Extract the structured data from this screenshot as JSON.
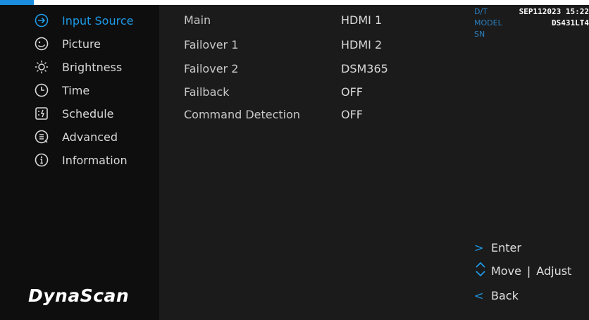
{
  "colors": {
    "accent": "#1e9ae6",
    "sidebar_bg": "#0e0e0e",
    "main_bg": "#1b1b1b"
  },
  "sidebar": {
    "items": [
      {
        "label": "Input Source",
        "icon": "input-arrow-icon",
        "active": true
      },
      {
        "label": "Picture",
        "icon": "picture-face-icon",
        "active": false
      },
      {
        "label": "Brightness",
        "icon": "brightness-sun-icon",
        "active": false
      },
      {
        "label": "Time",
        "icon": "clock-icon",
        "active": false
      },
      {
        "label": "Schedule",
        "icon": "schedule-icon",
        "active": false
      },
      {
        "label": "Advanced",
        "icon": "advanced-icon",
        "active": false
      },
      {
        "label": "Information",
        "icon": "info-icon",
        "active": false
      }
    ],
    "brand": "DynaScan"
  },
  "settings": [
    {
      "name": "Main",
      "value": "HDMI 1"
    },
    {
      "name": "Failover 1",
      "value": "HDMI 2"
    },
    {
      "name": "Failover 2",
      "value": "DSM365"
    },
    {
      "name": "Failback",
      "value": "OFF"
    },
    {
      "name": "Command Detection",
      "value": "OFF"
    }
  ],
  "info": {
    "dt_label": "D/T",
    "dt_value": "SEP112023 15:22",
    "model_label": "MODEL",
    "model_value": "DS431LT4",
    "sn_label": "SN",
    "sn_value": ""
  },
  "hints": {
    "enter_glyph": ">",
    "enter_label": "Enter",
    "move_label": "Move",
    "separator": "|",
    "adjust_label": "Adjust",
    "back_glyph": "<",
    "back_label": "Back"
  }
}
